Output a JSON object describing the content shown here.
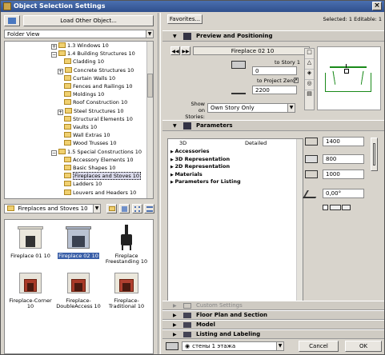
{
  "window": {
    "title": "Object Selection Settings",
    "close_label": "×"
  },
  "left": {
    "load_button": "Load Other Object...",
    "view_select": "Folder View",
    "tree": [
      {
        "label": "1.3 Windows 10",
        "pm": "+"
      },
      {
        "label": "1.4 Building Structures 10",
        "pm": "−"
      },
      {
        "label": "Cladding 10",
        "pm": ""
      },
      {
        "label": "Concrete Structures 10",
        "pm": "+"
      },
      {
        "label": "Curtain Walls 10",
        "pm": ""
      },
      {
        "label": "Fences and Railings 10",
        "pm": ""
      },
      {
        "label": "Moldings 10",
        "pm": ""
      },
      {
        "label": "Roof Construction 10",
        "pm": ""
      },
      {
        "label": "Steel Structures 10",
        "pm": "+"
      },
      {
        "label": "Structural Elements 10",
        "pm": ""
      },
      {
        "label": "Vaults 10",
        "pm": ""
      },
      {
        "label": "Wall Extras 10",
        "pm": ""
      },
      {
        "label": "Wood Trusses 10",
        "pm": ""
      },
      {
        "label": "1.5 Special Constructions 10",
        "pm": "−"
      },
      {
        "label": "Accessory Elements 10",
        "pm": ""
      },
      {
        "label": "Basic Shapes 10",
        "pm": ""
      },
      {
        "label": "Fireplaces and Stoves 10",
        "pm": "",
        "selected": true
      },
      {
        "label": "Ladders 10",
        "pm": ""
      },
      {
        "label": "Louvers and Headers 10",
        "pm": ""
      }
    ],
    "folder_select": "Fireplaces and Stoves 10",
    "items": [
      {
        "label": "Fireplace 01 10",
        "selected": false
      },
      {
        "label": "Fireplace 02 10",
        "selected": true
      },
      {
        "label": "Fireplace Freestanding 10",
        "selected": false
      },
      {
        "label": "Fireplace-Corner 10",
        "selected": false
      },
      {
        "label": "Fireplace-DoubleAccess 10",
        "selected": false
      },
      {
        "label": "Fireplace-Traditional 10",
        "selected": false
      }
    ]
  },
  "right": {
    "favorites_button": "Favorites...",
    "selected_info": "Selected: 1 Editable: 1",
    "preview": {
      "header": "Preview and Positioning",
      "name": "Fireplace 02 10",
      "to_story_label": "to Story 1",
      "to_story_value": "0",
      "to_project_zero_label": "to Project Zero",
      "to_project_zero_value": "2200",
      "show_on_label": "Show on Stories:",
      "show_on_value": "Own Story Only"
    },
    "parameters": {
      "header": "Parameters",
      "col1": "3D",
      "col2": "Detailed",
      "groups": [
        "Accessories",
        "3D Representation",
        "2D Representation",
        "Materials",
        "Parameters for Listing"
      ],
      "width": "1400",
      "depth": "800",
      "height": "1000",
      "angle": "0,00°"
    },
    "sections": [
      "Custom Settings",
      "Floor Plan and Section",
      "Model",
      "Listing and Labeling"
    ],
    "layer_value": "стены 1 этажа",
    "cancel": "Cancel",
    "ok": "OK"
  }
}
